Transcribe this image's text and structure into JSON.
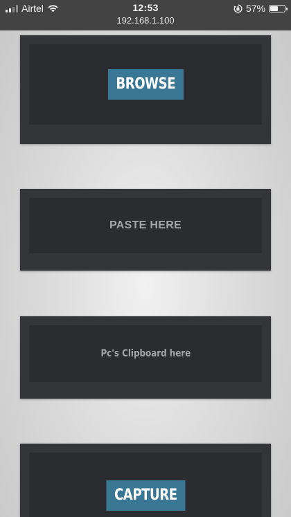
{
  "status_bar": {
    "carrier": "Airtel",
    "time": "12:53",
    "url": "192.168.1.100",
    "battery_text": "57%",
    "battery_level": 0.57,
    "signal_bars": 2,
    "wifi_icon": "wifi-icon",
    "orientation_lock_icon": "orientation-lock-icon"
  },
  "panels": {
    "browse": {
      "button_label": "BROWSE"
    },
    "paste": {
      "label": "PASTE HERE"
    },
    "clipboard": {
      "label": "Pc's Clipboard here"
    },
    "capture": {
      "button_label": "CAPTURE"
    }
  },
  "colors": {
    "accent": "#3a7794",
    "panel": "#333538",
    "panel_inner": "#2a2c2f",
    "status_bar": "#434343"
  }
}
